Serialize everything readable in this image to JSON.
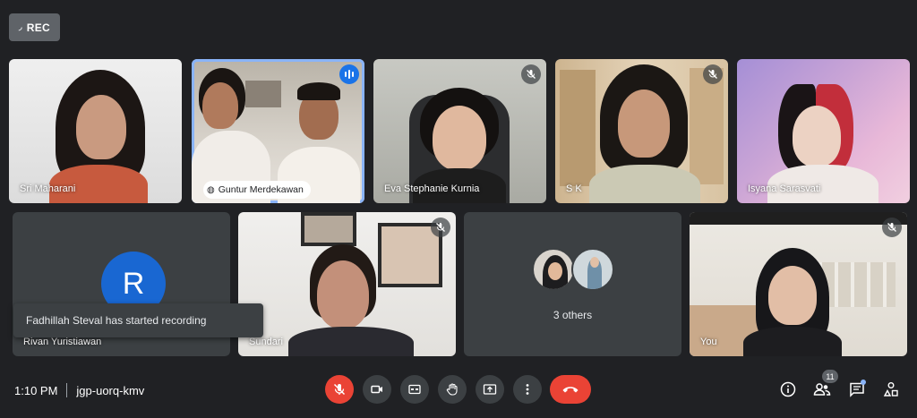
{
  "recording": {
    "label": "REC"
  },
  "tiles": [
    {
      "name": "Sri Maharani",
      "muted": false
    },
    {
      "name": "Guntur Merdekawan",
      "speaking": true
    },
    {
      "name": "Eva Stephanie Kurnia",
      "muted": true
    },
    {
      "name": "S K",
      "muted": true
    },
    {
      "name": "Isyana Sarasvati",
      "muted": false
    },
    {
      "name": "Rivan Yuristiawan",
      "avatar_letter": "R"
    },
    {
      "name": "Sundari",
      "muted": true
    },
    {
      "name": "3 others",
      "muted": false
    },
    {
      "name": "You",
      "muted": true
    }
  ],
  "toast": {
    "text": "Fadhillah Steval has started recording"
  },
  "meeting": {
    "time": "1:10 PM",
    "code": "jgp-uorq-kmv"
  },
  "people": {
    "count": "11"
  },
  "colors": {
    "accent": "#8ab4f8",
    "danger": "#ea4335",
    "avatar_blue": "#1967d2"
  }
}
